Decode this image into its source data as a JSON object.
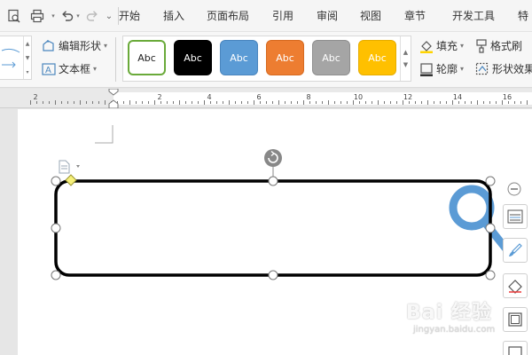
{
  "menu": {
    "tabs": [
      "开始",
      "插入",
      "页面布局",
      "引用",
      "审阅",
      "视图",
      "章节",
      "开发工具",
      "特"
    ]
  },
  "ribbon": {
    "edit_shape": "编辑形状",
    "text_box": "文本框",
    "fill": "填充",
    "outline": "轮廓",
    "format_painter": "格式刷",
    "shape_effects": "形状效果",
    "styles": [
      {
        "label": "Abc",
        "bg": "#ffffff",
        "fg": "#222222",
        "border": "#6aaa3a"
      },
      {
        "label": "Abc",
        "bg": "#000000",
        "fg": "#ffffff",
        "border": "#000000"
      },
      {
        "label": "Abc",
        "bg": "#5b9bd5",
        "fg": "#ffffff",
        "border": "#4a86be"
      },
      {
        "label": "Abc",
        "bg": "#ed7d31",
        "fg": "#ffffff",
        "border": "#d66a20"
      },
      {
        "label": "Abc",
        "bg": "#a5a5a5",
        "fg": "#ffffff",
        "border": "#8f8f8f"
      },
      {
        "label": "Abc",
        "bg": "#ffc000",
        "fg": "#ffffff",
        "border": "#e6ad00"
      }
    ]
  },
  "ruler": {
    "labels": [
      "2",
      "2",
      "4",
      "6",
      "8",
      "10",
      "12",
      "14",
      "16"
    ]
  },
  "watermark": {
    "text": "Bai 经验",
    "url": "jingyan.baidu.com"
  },
  "colors": {
    "accent_blue": "#5b9bd5",
    "handle_yellow": "#f6f07a",
    "shape_stroke": "#000000"
  }
}
